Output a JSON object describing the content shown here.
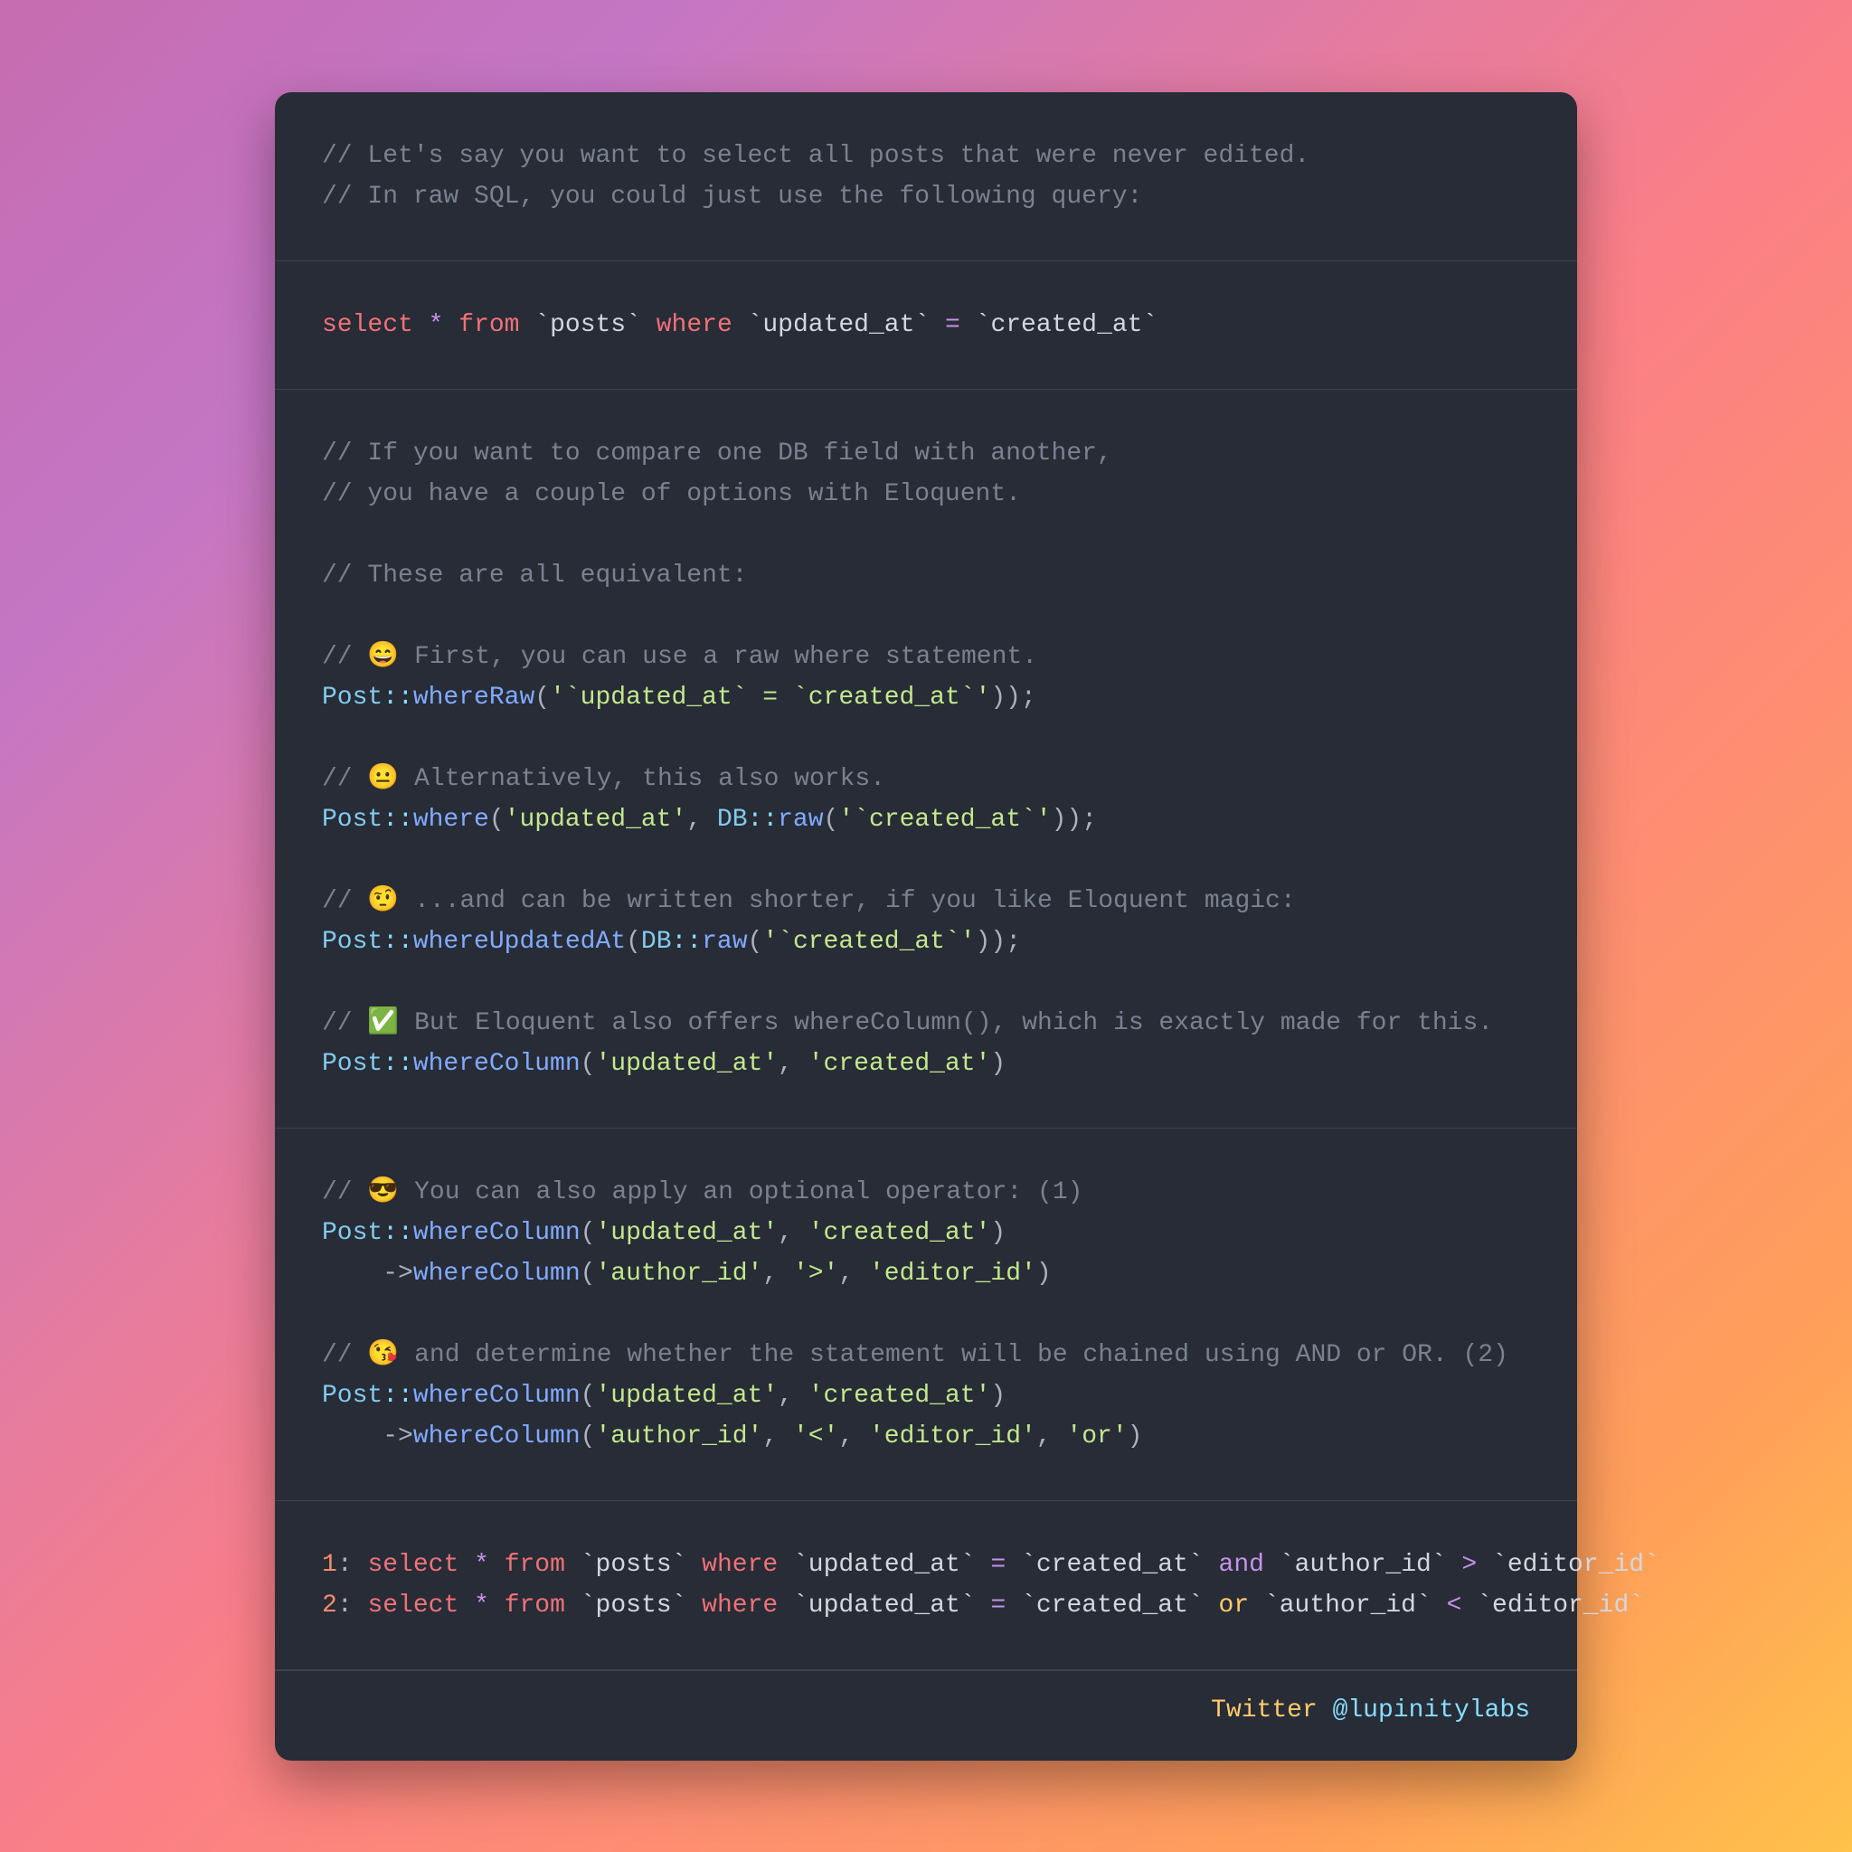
{
  "s1": {
    "c1": "// Let's say you want to select all posts that were never edited.",
    "c2": "// In raw SQL, you could just use the following query:"
  },
  "s2": {
    "select": "select",
    "star": "*",
    "from": "from",
    "posts": "`posts`",
    "where": "where",
    "ua": "`updated_at`",
    "eq": "=",
    "ca": "`created_at`"
  },
  "s3": {
    "c1": "// If you want to compare one DB field with another,",
    "c2": "// you have a couple of options with Eloquent.",
    "c3": "// These are all equivalent:",
    "c4a": "// ",
    "e1": "😄",
    "c4b": " First, you can use a raw where statement.",
    "Post": "Post",
    "dcol": "::",
    "whereRaw": "whereRaw",
    "lp": "(",
    "rp": ")",
    "semi": ";",
    "q1": "'`updated_at` = `created_at`'",
    "rp2": "))",
    "c5a": "// ",
    "e2": "😐",
    "c5b": " Alternatively, this also works.",
    "where": "where",
    "ua": "'updated_at'",
    "comma": ", ",
    "DB": "DB",
    "raw": "raw",
    "ca": "'`created_at`'",
    "c6a": "// ",
    "e3": "🤨",
    "c6b": " ...and can be written shorter, if you like Eloquent magic:",
    "whereUA": "whereUpdatedAt",
    "c7a": "// ",
    "e4": "✅",
    "c7b": " But Eloquent also offers whereColumn(), which is exactly made for this.",
    "whereColumn": "whereColumn",
    "ua2": "'updated_at'",
    "ca2": "'created_at'"
  },
  "s4": {
    "c1a": "// ",
    "e1": "😎",
    "c1b": " You can also apply an optional operator: (1)",
    "Post": "Post",
    "dcol": "::",
    "whereColumn": "whereColumn",
    "lp": "(",
    "rp": ")",
    "ua": "'updated_at'",
    "ca": "'created_at'",
    "comma": ", ",
    "indent": "    ->",
    "aid": "'author_id'",
    "gt": "'>'",
    "eid": "'editor_id'",
    "c2a": "// ",
    "e2": "😘",
    "c2b": " and determine whether the statement will be chained using AND or OR. (2)",
    "lt": "'<'",
    "or": "'or'"
  },
  "s5": {
    "l1_num": "1",
    "l2_num": "2",
    "colon": ":",
    "select": "select",
    "star": "*",
    "from": "from",
    "posts": "`posts`",
    "where": "where",
    "ua": "`updated_at`",
    "eq": "=",
    "ca": "`created_at`",
    "and_kw": "and",
    "or_kw": "or",
    "aid": "`author_id`",
    "gt": ">",
    "lt": "<",
    "eid": "`editor_id`"
  },
  "footer": {
    "tw": "Twitter ",
    "handle": "@lupinitylabs"
  }
}
